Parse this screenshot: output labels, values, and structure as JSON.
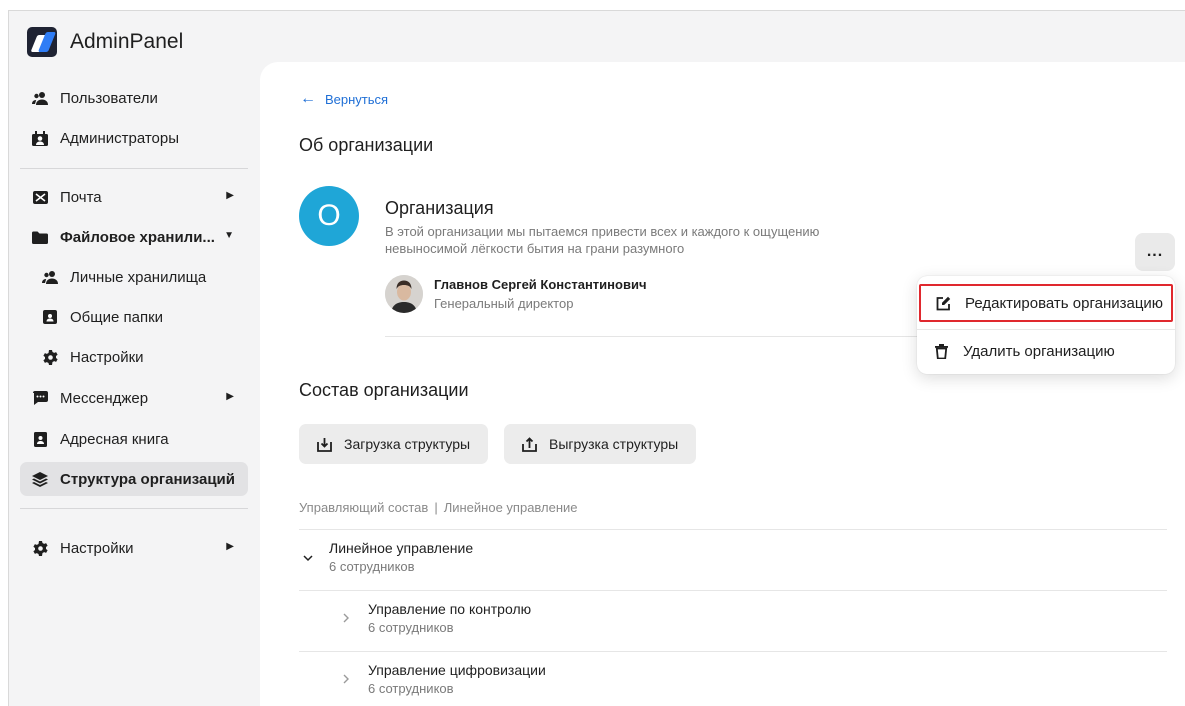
{
  "app": {
    "name": "AdminPanel"
  },
  "sidebar": {
    "items": [
      {
        "label": "Пользователи",
        "icon": "users-icon"
      },
      {
        "label": "Администраторы",
        "icon": "admins-icon"
      },
      {
        "label": "Почта",
        "icon": "mail-icon"
      },
      {
        "label": "Файловое хранили...",
        "icon": "folder-icon"
      },
      {
        "label": "Личные хранилища",
        "icon": "users-icon"
      },
      {
        "label": "Общие папки",
        "icon": "shared-folder-icon"
      },
      {
        "label": "Настройки",
        "icon": "gear-icon"
      },
      {
        "label": "Мессенджер",
        "icon": "chat-icon"
      },
      {
        "label": "Адресная книга",
        "icon": "address-book-icon"
      },
      {
        "label": "Структура организаций",
        "icon": "layers-icon"
      },
      {
        "label": "Настройки",
        "icon": "gear-icon"
      }
    ]
  },
  "main": {
    "back_label": "Вернуться",
    "about_heading": "Об организации",
    "org": {
      "avatar_letter": "O",
      "name": "Организация",
      "description": "В этой организации мы пытаемся привести всех и каждого к ощущению невыносимой лёгкости бытия на грани разумного",
      "accent_color": "#1fa6d7"
    },
    "director": {
      "name": "Главнов Сергей Константинович",
      "role": "Генеральный директор"
    },
    "more_label": "...",
    "menu": {
      "edit_label": "Редактировать организацию",
      "delete_label": "Удалить организацию"
    },
    "composition_heading": "Состав организации",
    "upload_label": "Загрузка структуры",
    "download_label": "Выгрузка структуры",
    "breadcrumb": {
      "first": "Управляющий состав",
      "separator": "|",
      "second": "Линейное управление"
    },
    "departments": [
      {
        "title": "Линейное управление",
        "count": "6 сотрудников",
        "expanded": true
      },
      {
        "title": "Управление по контролю",
        "count": "6 сотрудников",
        "expanded": false
      },
      {
        "title": "Управление цифровизации",
        "count": "6 сотрудников",
        "expanded": false
      }
    ]
  },
  "colors": {
    "link": "#1f6fd6",
    "highlight": "#e0282e",
    "active_nav": "#e2e2e4"
  }
}
